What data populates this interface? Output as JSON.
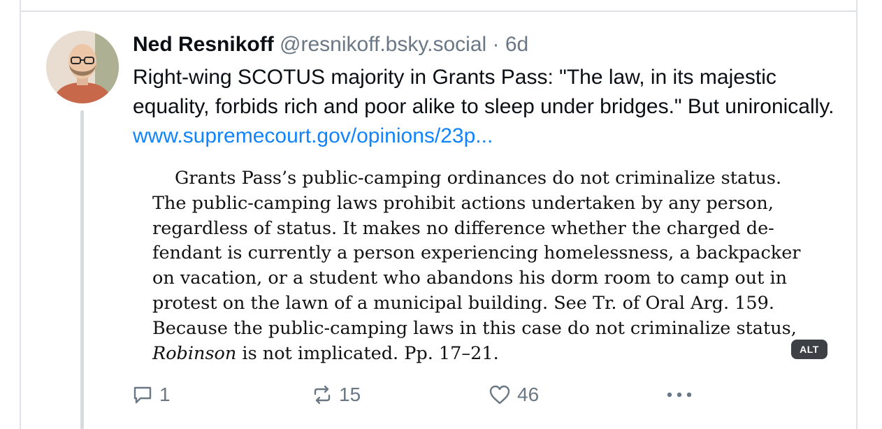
{
  "post": {
    "author_name": "Ned Resnikoff",
    "handle": "@resnikoff.bsky.social",
    "separator": "·",
    "age": "6d",
    "text": "Right-wing SCOTUS majority in Grants Pass: \"The law, in its majestic equality, forbids rich and poor alike to sleep under bridges.\" But unironically. ",
    "link_text": "www.supremecourt.gov/opinions/23p..."
  },
  "embed": {
    "lines": [
      "Grants Pass’s public-camping ordinances do not criminalize status.",
      "The public-camping laws prohibit actions undertaken by any person,",
      "regardless of status.  It makes no difference whether the charged de-",
      "fendant is currently a person experiencing homelessness, a backpacker",
      "on vacation, or a student who abandons his dorm room to camp out in",
      "protest on the lawn of a municipal building.  See Tr. of Oral Arg. 159.",
      "Because the public-camping laws in this case do not criminalize status,"
    ],
    "last_line_italic": "Robinson",
    "last_line_rest": " is not implicated.  Pp. 17–21.",
    "alt_label": "ALT"
  },
  "actions": {
    "reply_count": "1",
    "repost_count": "15",
    "like_count": "46"
  },
  "icons": {
    "reply": "speech-bubble-icon",
    "repost": "repost-arrows-icon",
    "like": "heart-icon",
    "more": "more-dots-icon"
  },
  "colors": {
    "link": "#1083fe",
    "muted": "#6a7785",
    "divider": "#dfe3e8",
    "alt_badge": "#3d4146"
  }
}
